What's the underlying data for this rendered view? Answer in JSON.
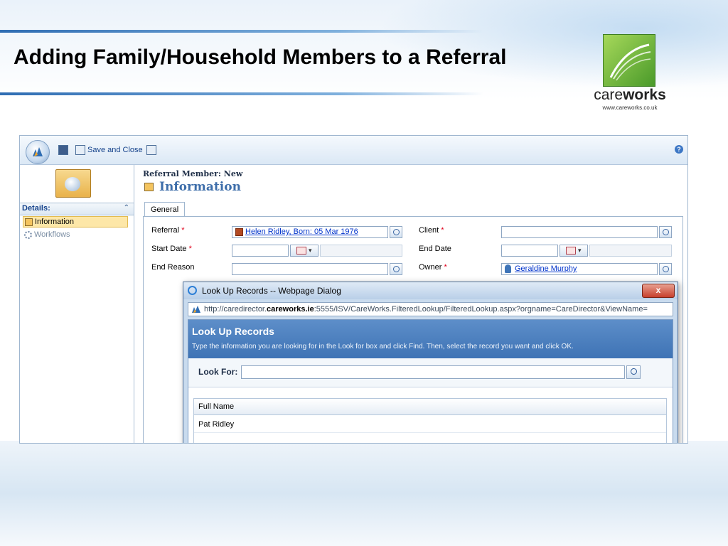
{
  "slide": {
    "title": "Adding Family/Household Members to a Referral",
    "logo": {
      "word_light": "care",
      "word_bold": "works",
      "url": "www.careworks.co.uk",
      "colors": {
        "green_light": "#a6d85a",
        "green_dark": "#4a9a2a"
      }
    }
  },
  "toolbar": {
    "save_and_close_label": "Save and Close",
    "icons": [
      "crm-orb-icon",
      "save-icon",
      "save-and-close-icon",
      "save-and-new-icon",
      "help-icon"
    ]
  },
  "left_nav": {
    "section_label": "Details:",
    "items": [
      {
        "label": "Information",
        "selected": true
      },
      {
        "label": "Workflows",
        "selected": false
      }
    ]
  },
  "record": {
    "type_label": "Referral Member: New",
    "title": "Information"
  },
  "tabs": [
    {
      "label": "General"
    }
  ],
  "form": {
    "referral_label": "Referral",
    "referral_value": "Helen Ridley, Born: 05 Mar 1976",
    "client_label": "Client",
    "client_value": "",
    "start_date_label": "Start Date",
    "start_date_value": "",
    "end_date_label": "End Date",
    "end_date_value": "",
    "end_reason_label": "End Reason",
    "end_reason_value": "",
    "owner_label": "Owner",
    "owner_value": "Geraldine Murphy",
    "required_marker": "*"
  },
  "dialog": {
    "window_title": "Look Up Records -- Webpage Dialog",
    "close_label": "x",
    "url_prefix": "http://caredirector.",
    "url_bold": "careworks.ie",
    "url_suffix": ":5555/ISV/CareWorks.FilteredLookup/FilteredLookup.aspx?orgname=CareDirector&ViewName=",
    "heading": "Look Up Records",
    "description": "Type the information you are looking for in the Look for box and click Find. Then, select the record you want and click OK.",
    "look_for_label": "Look For:",
    "look_for_value": "",
    "columns": [
      "Full Name"
    ],
    "rows": [
      [
        "Pat Ridley"
      ]
    ]
  },
  "colors": {
    "accent_blue": "#3e73b5",
    "link_blue": "#0033cc",
    "required_red": "#e0001b",
    "selected_nav": "#fde7a8"
  }
}
